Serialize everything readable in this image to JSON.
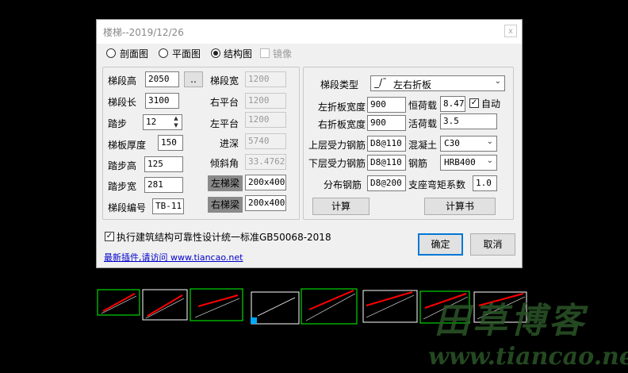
{
  "dialog": {
    "title": "楼梯--2019/12/26",
    "close_glyph": "x"
  },
  "view_mode": {
    "options": [
      {
        "label": "剖面图",
        "selected": false
      },
      {
        "label": "平面图",
        "selected": false
      },
      {
        "label": "结构图",
        "selected": true
      }
    ],
    "mirror_label": "镜像",
    "mirror_checked": false
  },
  "left_group": {
    "segment_height_label": "梯段高",
    "segment_height": "2050",
    "browse_label": "..",
    "segment_length_label": "梯段长",
    "segment_length": "3100",
    "steps_label": "踏步",
    "steps": "12",
    "slab_thickness_label": "梯板厚度",
    "slab_thickness": "150",
    "step_height_label": "踏步高",
    "step_height": "125",
    "step_width_label": "踏步宽",
    "step_width": "281",
    "segment_code_label": "梯段编号",
    "segment_code": "TB-11",
    "segment_width_label": "梯段宽",
    "segment_width": "1200",
    "right_platform_label": "右平台",
    "right_platform": "1200",
    "left_platform_label": "左平台",
    "left_platform": "1200",
    "depth_label": "进深",
    "depth": "5740",
    "angle_label": "倾斜角",
    "angle": "33.47627",
    "left_beam_label": "左梯梁",
    "left_beam": "200x400",
    "right_beam_label": "右梯梁",
    "right_beam": "200x400"
  },
  "right_group": {
    "stair_type_label": "梯段类型",
    "stair_type_value": "左右折板",
    "left_fold_width_label": "左折板宽度",
    "left_fold_width": "900",
    "right_fold_width_label": "右折板宽度",
    "right_fold_width": "900",
    "upper_rebar_label": "上层受力钢筋",
    "upper_rebar": "D8@110",
    "lower_rebar_label": "下层受力钢筋",
    "lower_rebar": "D8@110",
    "dist_rebar_label": "分布钢筋",
    "dist_rebar": "D8@200",
    "dead_load_label": "恒荷载",
    "dead_load": "8.47",
    "auto_label": "自动",
    "auto_checked": true,
    "live_load_label": "活荷载",
    "live_load": "3.5",
    "concrete_label": "混凝土",
    "concrete": "C30",
    "rebar_label": "钢筋",
    "rebar": "HRB400",
    "moment_coef_label": "支座弯矩系数",
    "moment_coef": "1.0",
    "calc_label": "计算",
    "calc_book_label": "计算书"
  },
  "standard": {
    "checked": true,
    "label": "执行建筑结构可靠性设计统一标准GB50068-2018"
  },
  "link_text": "最新插件,请访问 www.tiancao.net",
  "ok_label": "确定",
  "cancel_label": "取消",
  "watermark": {
    "title": "田草博客",
    "url": "www.tiancao.net"
  },
  "colors": {
    "background": "#000000",
    "dialog": "#f0f0f0",
    "accent": "#0078d7",
    "cad_green": "#00ff00",
    "cad_red": "#ff0000"
  }
}
